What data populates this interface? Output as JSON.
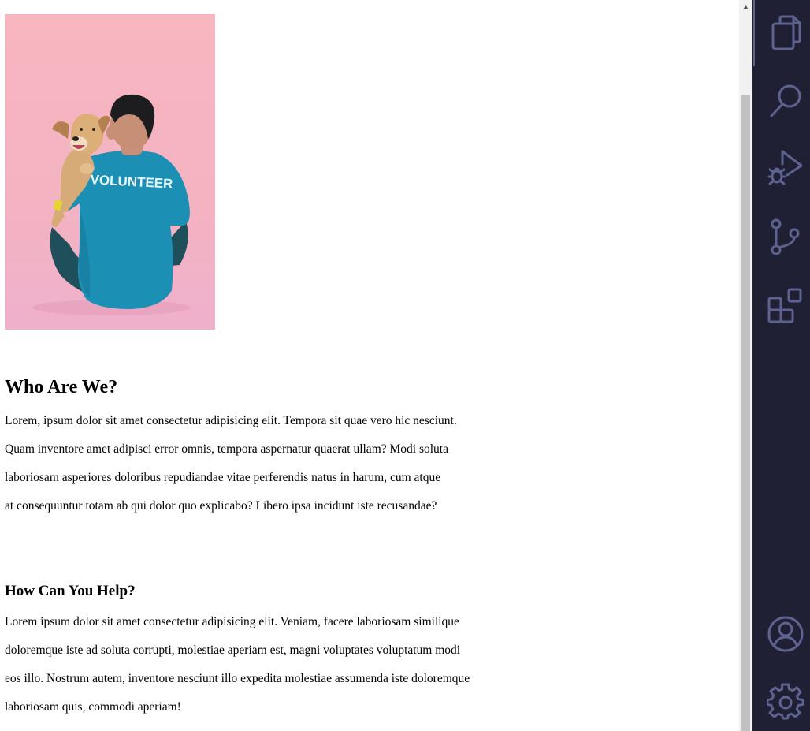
{
  "hero_image": {
    "shirt_text": "VOLUNTEER"
  },
  "about": {
    "heading": "Who Are We?",
    "lines": [
      "Lorem, ipsum dolor sit amet consectetur adipisicing elit. Tempora sit quae vero hic nesciunt.",
      "Quam inventore amet adipisci error omnis, tempora aspernatur quaerat ullam? Modi soluta",
      "laboriosam asperiores doloribus repudiandae vitae perferendis natus in harum, cum atque",
      "at consequuntur totam ab qui dolor quo explicabo? Libero ipsa incidunt iste recusandae?"
    ]
  },
  "help": {
    "heading": "How Can You Help?",
    "lines": [
      "Lorem ipsum dolor sit amet consectetur adipisicing elit. Veniam, facere laboriosam similique",
      "doloremque iste ad soluta corrupti, molestiae aperiam est, magni voluptates voluptatum modi",
      "eos illo. Nostrum autem, inventore nesciunt illo expedita molestiae assumenda iste doloremque",
      "laboriosam quis, commodi aperiam!"
    ]
  },
  "activity_bar": {
    "background": "#1f2033",
    "icon_color": "#5e6290",
    "top_icons": [
      "explorer-icon",
      "search-icon",
      "run-debug-icon",
      "source-control-icon",
      "extensions-icon"
    ],
    "bottom_icons": [
      "account-icon",
      "settings-gear-icon"
    ]
  },
  "scrollbar": {
    "up_arrow": "▲"
  }
}
